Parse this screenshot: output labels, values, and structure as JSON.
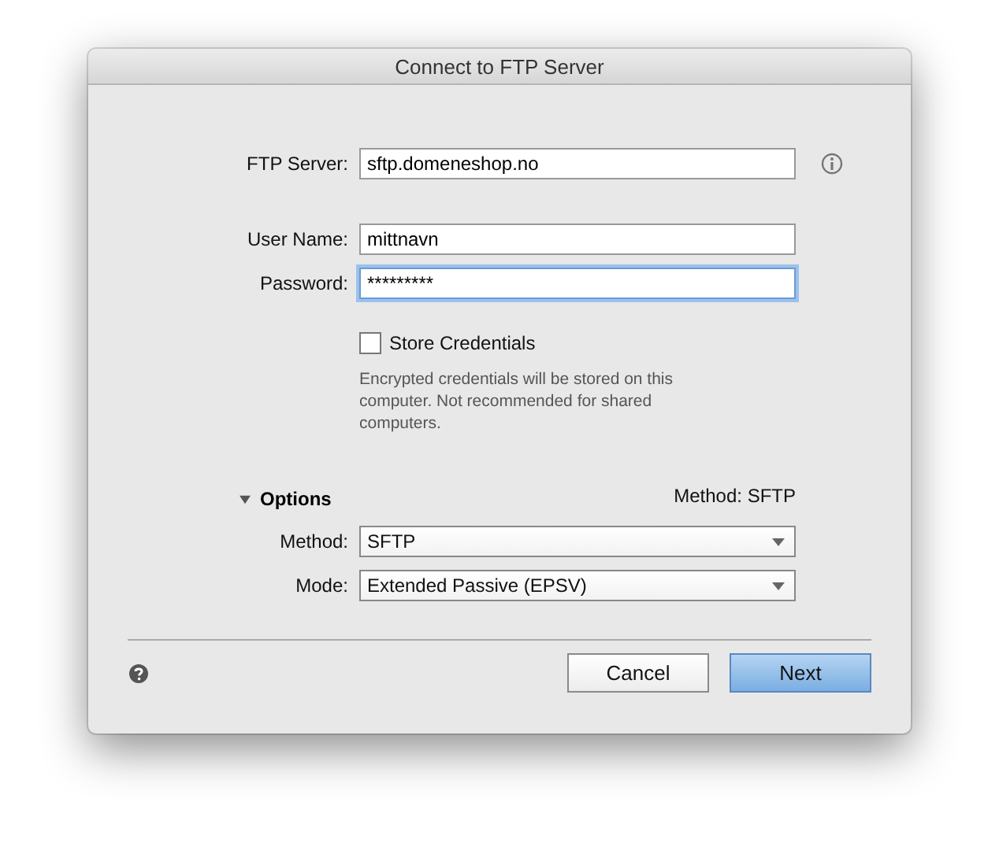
{
  "window": {
    "title": "Connect to FTP Server"
  },
  "server": {
    "label": "FTP Server:",
    "value": "sftp.domeneshop.no"
  },
  "user": {
    "label": "User Name:",
    "value": "mittnavn"
  },
  "password": {
    "label": "Password:",
    "value": "*********",
    "focused": true
  },
  "store_credentials": {
    "label": "Store Credentials",
    "checked": false
  },
  "note": "Encrypted credentials will be stored on this computer. Not recommended for shared computers.",
  "options": {
    "label": "Options",
    "expanded": true,
    "summary": "Method: SFTP"
  },
  "method": {
    "label": "Method:",
    "value": "SFTP"
  },
  "mode": {
    "label": "Mode:",
    "value": "Extended Passive (EPSV)"
  },
  "buttons": [
    {
      "label": "Cancel",
      "kind": "secondary"
    },
    {
      "label": "Next",
      "kind": "primary"
    }
  ]
}
